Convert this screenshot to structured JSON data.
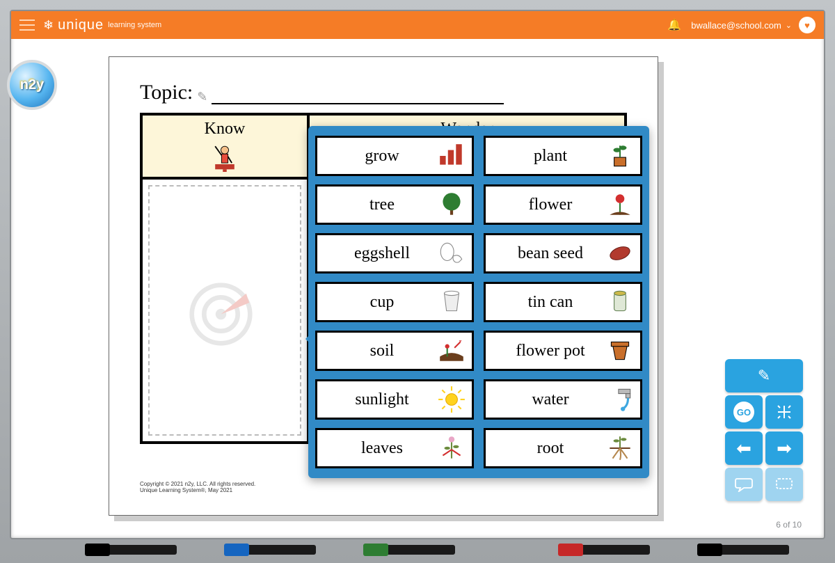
{
  "header": {
    "brand_main": "unique",
    "brand_sub": "learning system",
    "user_email": "bwallace@school.com"
  },
  "n2y_badge": "n2y",
  "worksheet": {
    "topic_label": "Topic:",
    "columns": {
      "know": "Know",
      "wonder": "Wonder"
    },
    "copyright_line1": "Copyright © 2021 n2y, LLC. All rights reserved.",
    "copyright_line2": "Unique Learning System®, May 2021"
  },
  "picker": {
    "words": [
      {
        "label": "grow",
        "icon": "bars"
      },
      {
        "label": "plant",
        "icon": "pottedplant"
      },
      {
        "label": "tree",
        "icon": "tree"
      },
      {
        "label": "flower",
        "icon": "flower"
      },
      {
        "label": "eggshell",
        "icon": "eggshell"
      },
      {
        "label": "bean seed",
        "icon": "bean"
      },
      {
        "label": "cup",
        "icon": "cup"
      },
      {
        "label": "tin can",
        "icon": "can"
      },
      {
        "label": "soil",
        "icon": "soil"
      },
      {
        "label": "flower pot",
        "icon": "flowerpot"
      },
      {
        "label": "sunlight",
        "icon": "sun"
      },
      {
        "label": "water",
        "icon": "faucet"
      },
      {
        "label": "leaves",
        "icon": "leaves"
      },
      {
        "label": "root",
        "icon": "root"
      }
    ]
  },
  "toolbox": {
    "go_label": "GO"
  },
  "page_counter": "6 of 10"
}
